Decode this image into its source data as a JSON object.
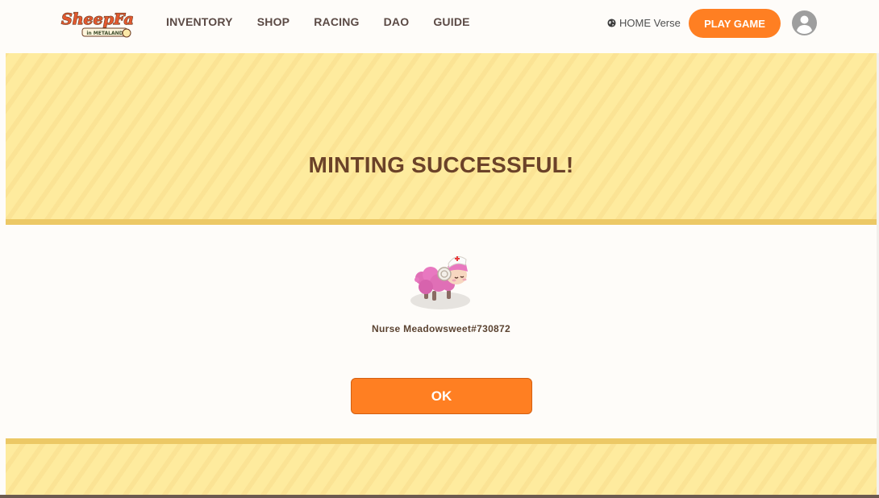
{
  "brand": {
    "logo_text": "SheepFarm",
    "logo_sub": "in METALAND",
    "accent_color": "#ff7f22",
    "title_color": "#6b4229"
  },
  "nav": {
    "items": [
      {
        "label": "INVENTORY"
      },
      {
        "label": "SHOP"
      },
      {
        "label": "RACING"
      },
      {
        "label": "DAO"
      },
      {
        "label": "GUIDE"
      }
    ],
    "verse_label": "HOME Verse",
    "verse_icon": "globe-icon",
    "play_label": "PLAY GAME",
    "profile_icon": "user-avatar-icon"
  },
  "modal": {
    "title": "MINTING SUCCESSFUL!",
    "nft_name": "Nurse Meadowsweet#730872",
    "nft_image": "pink-nurse-sheep",
    "ok_label": "OK"
  }
}
